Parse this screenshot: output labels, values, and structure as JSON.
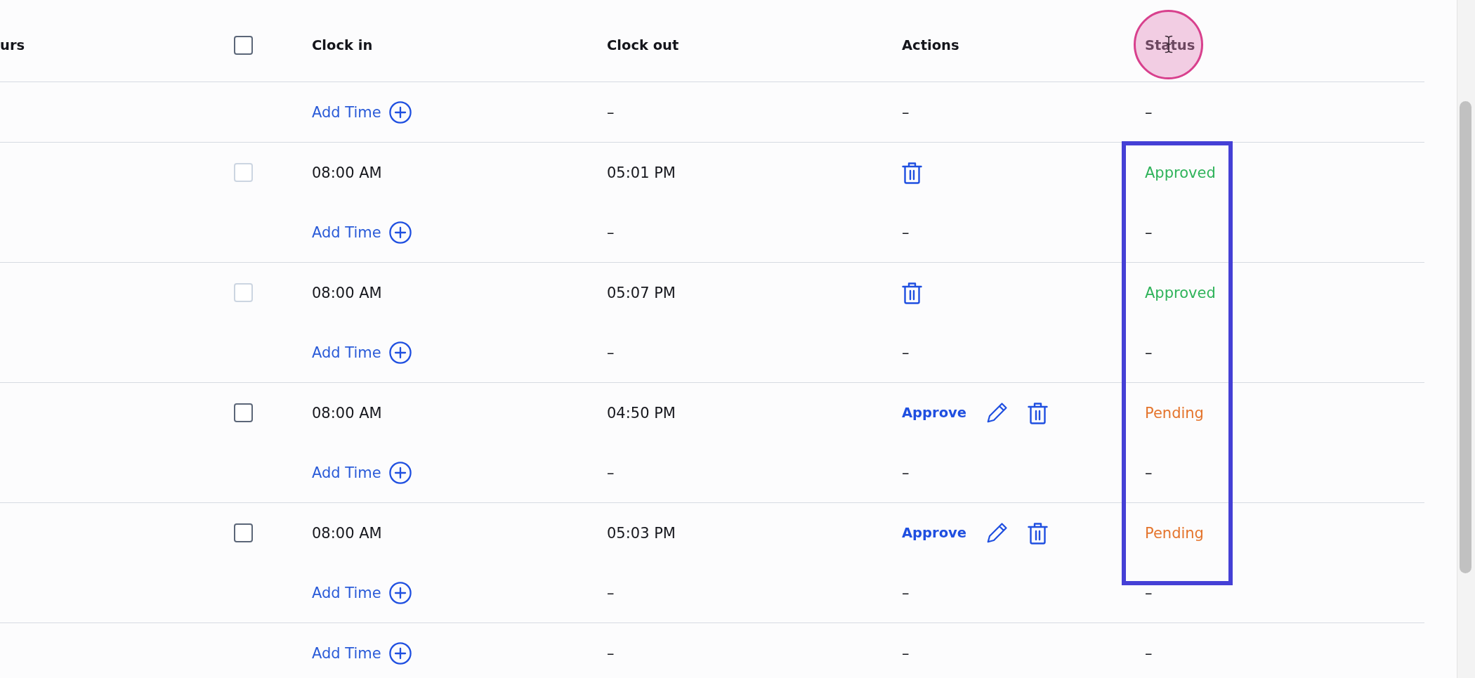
{
  "header": {
    "column_1": "urs",
    "select_all": {
      "checked": false,
      "disabled": false
    },
    "clock_in": "Clock in",
    "clock_out": "Clock out",
    "actions": "Actions",
    "status": "Status"
  },
  "days": [
    {
      "add_row": {
        "link": "Add Time",
        "clock_out": "–",
        "actions": "–",
        "status": "–"
      }
    },
    {
      "entries": [
        {
          "checkbox": {
            "checked": false,
            "disabled": true
          },
          "clock_in": "08:00 AM",
          "clock_out": "05:01 PM",
          "actions": [
            {
              "kind": "delete"
            }
          ],
          "status": {
            "text": "Approved",
            "color": "#2fb35a"
          }
        }
      ],
      "add_row": {
        "link": "Add Time",
        "clock_out": "–",
        "actions": "–",
        "status": "–"
      }
    },
    {
      "entries": [
        {
          "checkbox": {
            "checked": false,
            "disabled": true
          },
          "clock_in": "08:00 AM",
          "clock_out": "05:07 PM",
          "actions": [
            {
              "kind": "delete"
            }
          ],
          "status": {
            "text": "Approved",
            "color": "#2fb35a"
          }
        }
      ],
      "add_row": {
        "link": "Add Time",
        "clock_out": "–",
        "actions": "–",
        "status": "–"
      }
    },
    {
      "entries": [
        {
          "checkbox": {
            "checked": false,
            "disabled": false
          },
          "clock_in": "08:00 AM",
          "clock_out": "04:50 PM",
          "actions": [
            {
              "kind": "approve",
              "label": "Approve"
            },
            {
              "kind": "edit"
            },
            {
              "kind": "delete"
            }
          ],
          "status": {
            "text": "Pending",
            "color": "#e4742c"
          }
        }
      ],
      "add_row": {
        "link": "Add Time",
        "clock_out": "–",
        "actions": "–",
        "status": "–"
      }
    },
    {
      "entries": [
        {
          "checkbox": {
            "checked": false,
            "disabled": false
          },
          "clock_in": "08:00 AM",
          "clock_out": "05:03 PM",
          "actions": [
            {
              "kind": "approve",
              "label": "Approve"
            },
            {
              "kind": "edit"
            },
            {
              "kind": "delete"
            }
          ],
          "status": {
            "text": "Pending",
            "color": "#e4742c"
          }
        }
      ],
      "add_row": {
        "link": "Add Time",
        "clock_out": "–",
        "actions": "–",
        "status": "–"
      }
    },
    {
      "add_row": {
        "link": "Add Time",
        "clock_out": "–",
        "actions": "–",
        "status": "–"
      }
    }
  ],
  "annotations": {
    "click_marker": true,
    "highlight_box": true
  }
}
